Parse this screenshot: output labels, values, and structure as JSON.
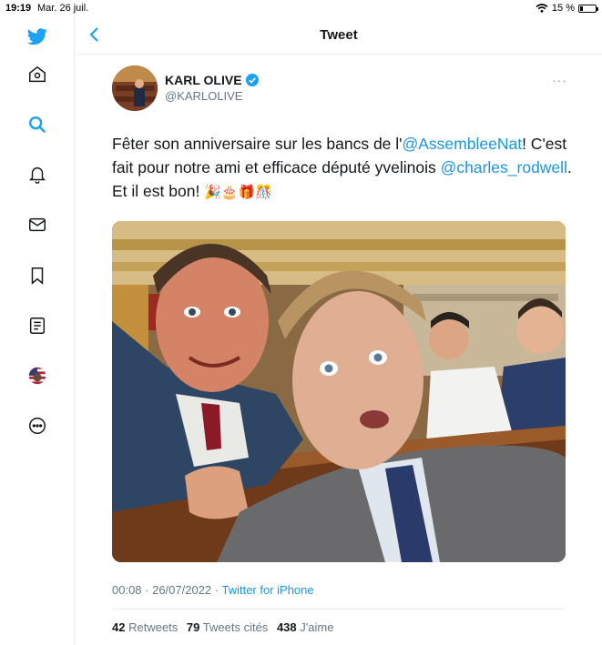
{
  "statusbar": {
    "time": "19:19",
    "date": "Mar. 26 juil.",
    "battery": "15 %",
    "battery_level": 0.15
  },
  "nav": {
    "items": [
      {
        "icon": "twitter-logo-icon"
      },
      {
        "icon": "home-icon"
      },
      {
        "icon": "search-icon"
      },
      {
        "icon": "notifications-bell-icon"
      },
      {
        "icon": "messages-envelope-icon"
      },
      {
        "icon": "bookmark-icon"
      },
      {
        "icon": "lists-icon"
      },
      {
        "icon": "profile-avatar-icon"
      },
      {
        "icon": "more-icon"
      }
    ]
  },
  "header": {
    "title": "Tweet",
    "back_icon": "chevron-left-icon"
  },
  "tweet": {
    "author_name": "KARL OLIVE",
    "author_handle": "@KARLOLIVE",
    "more": "···",
    "text_part1": "Fêter son anniversaire sur les bancs de l'",
    "mention1": "@AssembleeNat",
    "text_part2": "! C'est fait pour notre ami et efficace député yvelinois ",
    "mention2": "@charles_rodwell",
    "text_part3": ". Et il est bon! ",
    "emojis": "🎉🎂🎁🎊",
    "time": "00:08 · 26/07/2022 · ",
    "source": "Twitter for iPhone",
    "retweets_count": "42",
    "retweets_label": "Retweets",
    "quotes_count": "79",
    "quotes_label": "Tweets cités",
    "likes_count": "438",
    "likes_label": "J'aime"
  },
  "colors": {
    "accent": "#1da1f2",
    "link": "#1b95e0",
    "muted": "#657786",
    "border": "#e6ecf0"
  }
}
